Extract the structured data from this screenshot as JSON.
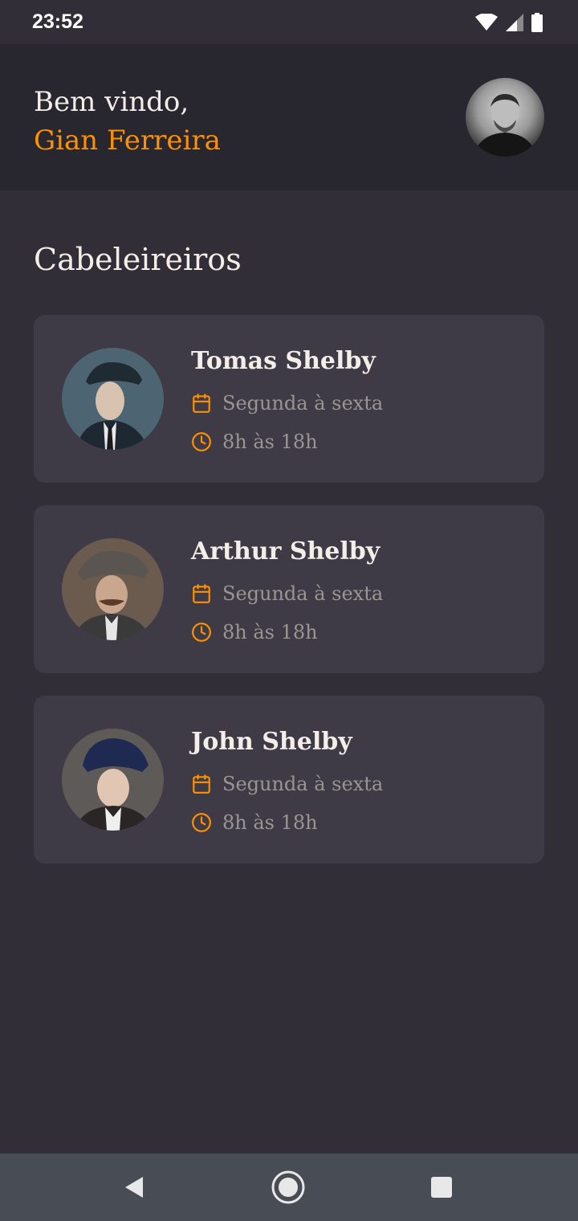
{
  "status_bar": {
    "time": "23:52",
    "icons": [
      "wifi-icon",
      "signal-icon",
      "battery-icon"
    ]
  },
  "header": {
    "greeting": "Bem vindo,",
    "user_name": "Gian Ferreira",
    "avatar_icon": "user-avatar"
  },
  "section": {
    "title": "Cabeleireiros"
  },
  "providers": [
    {
      "name": "Tomas Shelby",
      "days": "Segunda à sexta",
      "hours": "8h às 18h"
    },
    {
      "name": "Arthur Shelby",
      "days": "Segunda à sexta",
      "hours": "8h às 18h"
    },
    {
      "name": "John Shelby",
      "days": "Segunda à sexta",
      "hours": "8h às 18h"
    }
  ],
  "nav": {
    "icons": [
      "back-icon",
      "home-icon",
      "recents-icon"
    ]
  },
  "colors": {
    "background": "#312e38",
    "header": "#28262e",
    "card": "#3e3b47",
    "accent": "#ff9000",
    "text": "#f4ede8",
    "muted": "#999591",
    "nav_bar": "#484c54"
  }
}
